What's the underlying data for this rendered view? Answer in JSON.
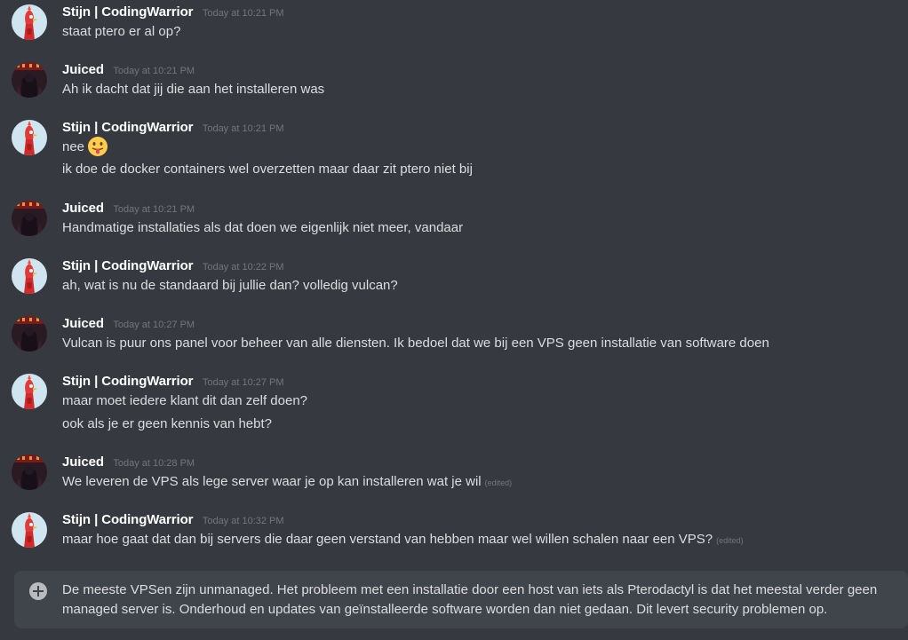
{
  "messages": [
    {
      "author": "Stijn | CodingWarrior",
      "timestamp": "Today at 10:21 PM",
      "avatar": "stijn",
      "lines": [
        "staat ptero er al op?"
      ]
    },
    {
      "author": "Juiced",
      "timestamp": "Today at 10:21 PM",
      "avatar": "juiced",
      "lines": [
        "Ah ik dacht dat jij die aan het installeren was"
      ]
    },
    {
      "author": "Stijn | CodingWarrior",
      "timestamp": "Today at 10:21 PM",
      "avatar": "stijn",
      "lines": [
        "nee",
        "ik doe de docker containers wel overzetten maar daar zit ptero niet bij"
      ],
      "emoji": "stuck-out-tongue-emoji"
    },
    {
      "author": "Juiced",
      "timestamp": "Today at 10:21 PM",
      "avatar": "juiced",
      "lines": [
        "Handmatige installaties als dat doen we eigenlijk niet meer, vandaar"
      ]
    },
    {
      "author": "Stijn | CodingWarrior",
      "timestamp": "Today at 10:22 PM",
      "avatar": "stijn",
      "lines": [
        "ah, wat is nu de standaard bij jullie dan? volledig vulcan?"
      ]
    },
    {
      "author": "Juiced",
      "timestamp": "Today at 10:27 PM",
      "avatar": "juiced",
      "lines": [
        "Vulcan is puur ons panel voor beheer van alle diensten. Ik bedoel dat we bij een VPS geen installatie van software doen"
      ]
    },
    {
      "author": "Stijn | CodingWarrior",
      "timestamp": "Today at 10:27 PM",
      "avatar": "stijn",
      "lines": [
        "maar moet iedere klant dit dan zelf doen?",
        "ook als je er geen kennis van hebt?"
      ]
    },
    {
      "author": "Juiced",
      "timestamp": "Today at 10:28 PM",
      "avatar": "juiced",
      "lines": [
        "We leveren de VPS als lege server waar je op kan installeren wat je wil"
      ],
      "edited": "(edited)"
    },
    {
      "author": "Stijn | CodingWarrior",
      "timestamp": "Today at 10:32 PM",
      "avatar": "stijn",
      "lines": [
        "maar hoe gaat dat dan bij servers die daar geen verstand van hebben maar wel willen schalen naar een VPS?"
      ],
      "edited": "(edited)"
    }
  ],
  "composer": {
    "text": "De meeste VPSen zijn unmanaged. Het probleem met een installatie door een host van iets als Pterodactyl is dat het meestal verder geen managed server is. Onderhoud en updates van geïnstalleerde software worden dan niet gedaan. Dit levert security problemen op.",
    "attach_icon": "plus-circle-icon"
  },
  "colors": {
    "background": "#36393f",
    "composer": "#40444b",
    "author": "#ffffff",
    "text": "#dcddde",
    "muted": "#72767d",
    "stijn_avatar_bg": "#cfe6f0",
    "juiced_avatar_bg": "#2a1a22"
  }
}
